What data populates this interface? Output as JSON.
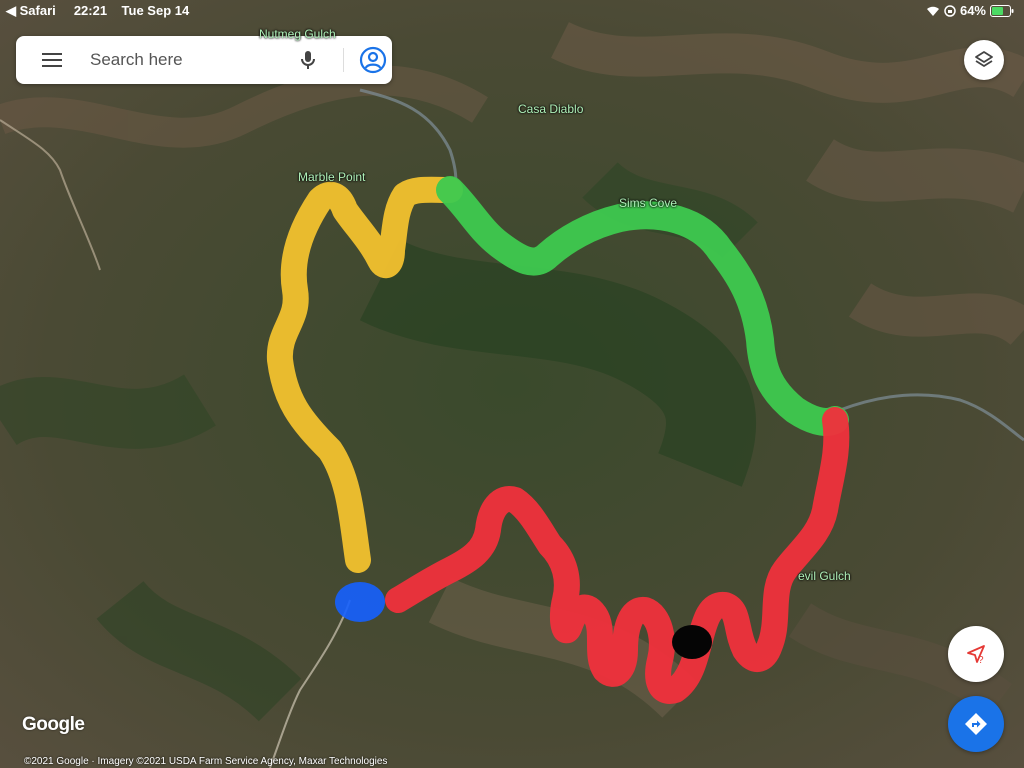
{
  "status_bar": {
    "app": "Safari",
    "time": "22:21",
    "date": "Tue Sep 14",
    "battery": "64%"
  },
  "search": {
    "placeholder": "Search here"
  },
  "map": {
    "place_labels": {
      "nutmeg_gulch": "Nutmeg Gulch",
      "casa_diablo": "Casa Diablo",
      "marble_point": "Marble Point",
      "sims_cove": "Sims Cove",
      "devil_gulch": "evil Gulch"
    },
    "route_colors": {
      "yellow": "#f2c12e",
      "green": "#3ec94f",
      "red": "#f0303c",
      "blue": "#1560ff",
      "black": "#050505"
    }
  },
  "brand": "Google",
  "copyright": "©2021 Google · Imagery ©2021 USDA Farm Service Agency, Maxar Technologies",
  "colors": {
    "directions_button": "#1a73e8",
    "account_icon": "#1a73e8"
  }
}
